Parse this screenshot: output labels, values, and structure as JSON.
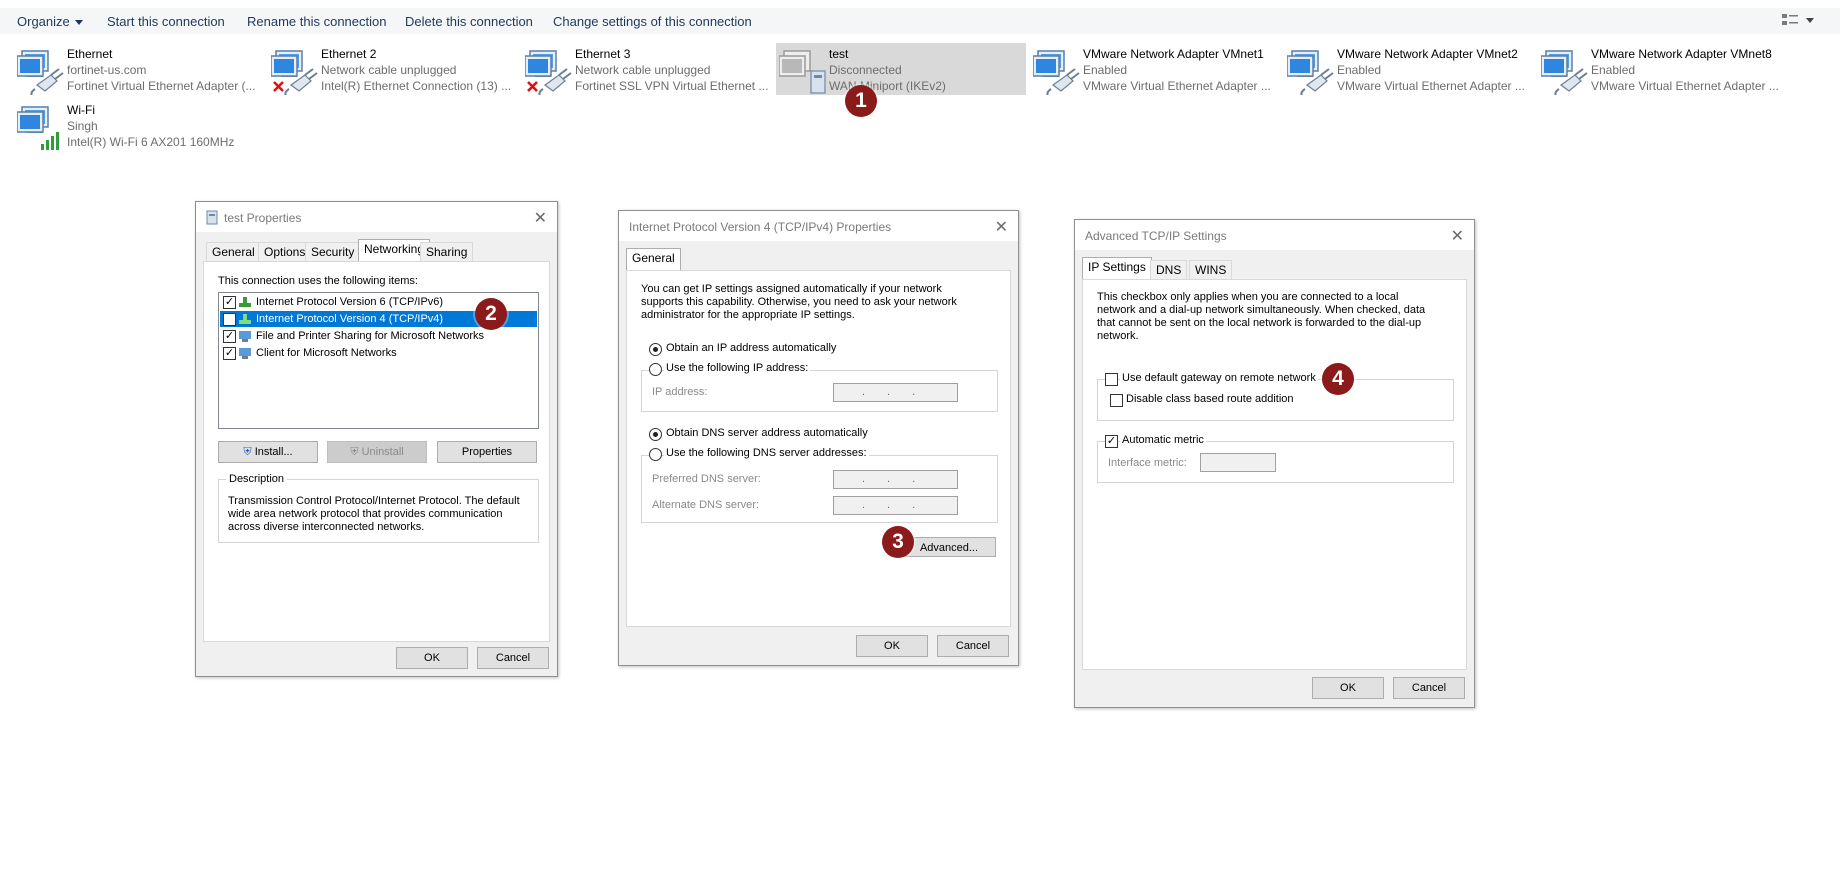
{
  "toolbar": {
    "organize": "Organize",
    "start": "Start this connection",
    "rename": "Rename this connection",
    "delete": "Delete this connection",
    "change": "Change settings of this connection"
  },
  "connections": [
    {
      "name": "Ethernet",
      "status": "fortinet-us.com",
      "device": "Fortinet Virtual Ethernet Adapter (..."
    },
    {
      "name": "Ethernet 2",
      "status": "Network cable unplugged",
      "device": "Intel(R) Ethernet Connection (13) ..."
    },
    {
      "name": "Ethernet 3",
      "status": "Network cable unplugged",
      "device": "Fortinet SSL VPN Virtual Ethernet ..."
    },
    {
      "name": "test",
      "status": "Disconnected",
      "device": "WAN Miniport (IKEv2)"
    },
    {
      "name": "VMware Network Adapter VMnet1",
      "status": "Enabled",
      "device": "VMware Virtual Ethernet Adapter ..."
    },
    {
      "name": "VMware Network Adapter VMnet2",
      "status": "Enabled",
      "device": "VMware Virtual Ethernet Adapter ..."
    },
    {
      "name": "VMware Network Adapter VMnet8",
      "status": "Enabled",
      "device": "VMware Virtual Ethernet Adapter ..."
    },
    {
      "name": "Wi-Fi",
      "status": "Singh",
      "device": "Intel(R) Wi-Fi 6 AX201 160MHz"
    }
  ],
  "badges": [
    "1",
    "2",
    "3",
    "4"
  ],
  "test_props": {
    "title": "test Properties",
    "tabs": [
      "General",
      "Options",
      "Security",
      "Networking",
      "Sharing"
    ],
    "active_tab": "Networking",
    "list_label": "This connection uses the following items:",
    "items": [
      {
        "label": "Internet Protocol Version 6 (TCP/IPv6)",
        "checked": true
      },
      {
        "label": "Internet Protocol Version 4 (TCP/IPv4)",
        "checked": true,
        "selected": true
      },
      {
        "label": "File and Printer Sharing for Microsoft Networks",
        "checked": true
      },
      {
        "label": "Client for Microsoft Networks",
        "checked": true
      }
    ],
    "install": "Install...",
    "uninstall": "Uninstall",
    "properties": "Properties",
    "desc_label": "Description",
    "desc_lines": [
      "Transmission Control Protocol/Internet Protocol. The default",
      "wide area network protocol that provides communication",
      "across diverse interconnected networks."
    ],
    "ok": "OK",
    "cancel": "Cancel"
  },
  "ipv4_props": {
    "title": "Internet Protocol Version 4 (TCP/IPv4) Properties",
    "tab": "General",
    "intro": [
      "You can get IP settings assigned automatically if your network",
      "supports this capability. Otherwise, you need to ask your network",
      "administrator for the appropriate IP settings."
    ],
    "obtain_ip": "Obtain an IP address automatically",
    "use_ip": "Use the following IP address:",
    "ip_label": "IP address:",
    "obtain_dns": "Obtain DNS server address automatically",
    "use_dns": "Use the following DNS server addresses:",
    "pref_dns": "Preferred DNS server:",
    "alt_dns": "Alternate DNS server:",
    "ip_placeholder": "...",
    "advanced": "Advanced...",
    "ok": "OK",
    "cancel": "Cancel"
  },
  "adv_tcpip": {
    "title": "Advanced TCP/IP Settings",
    "tabs": [
      "IP Settings",
      "DNS",
      "WINS"
    ],
    "active_tab": "IP Settings",
    "info": [
      "This checkbox only applies when you are connected to a local",
      "network and a dial-up network simultaneously.  When checked, data",
      "that cannot be sent on the local network is forwarded to the dial-up",
      "network."
    ],
    "use_gateway": "Use default gateway on remote network",
    "disable_class": "Disable class based route addition",
    "auto_metric": "Automatic metric",
    "iface_metric": "Interface metric:",
    "ok": "OK",
    "cancel": "Cancel"
  },
  "colors": {
    "badge": "#8b1a1a",
    "selection": "#0078d7",
    "link": "#1e395b"
  }
}
